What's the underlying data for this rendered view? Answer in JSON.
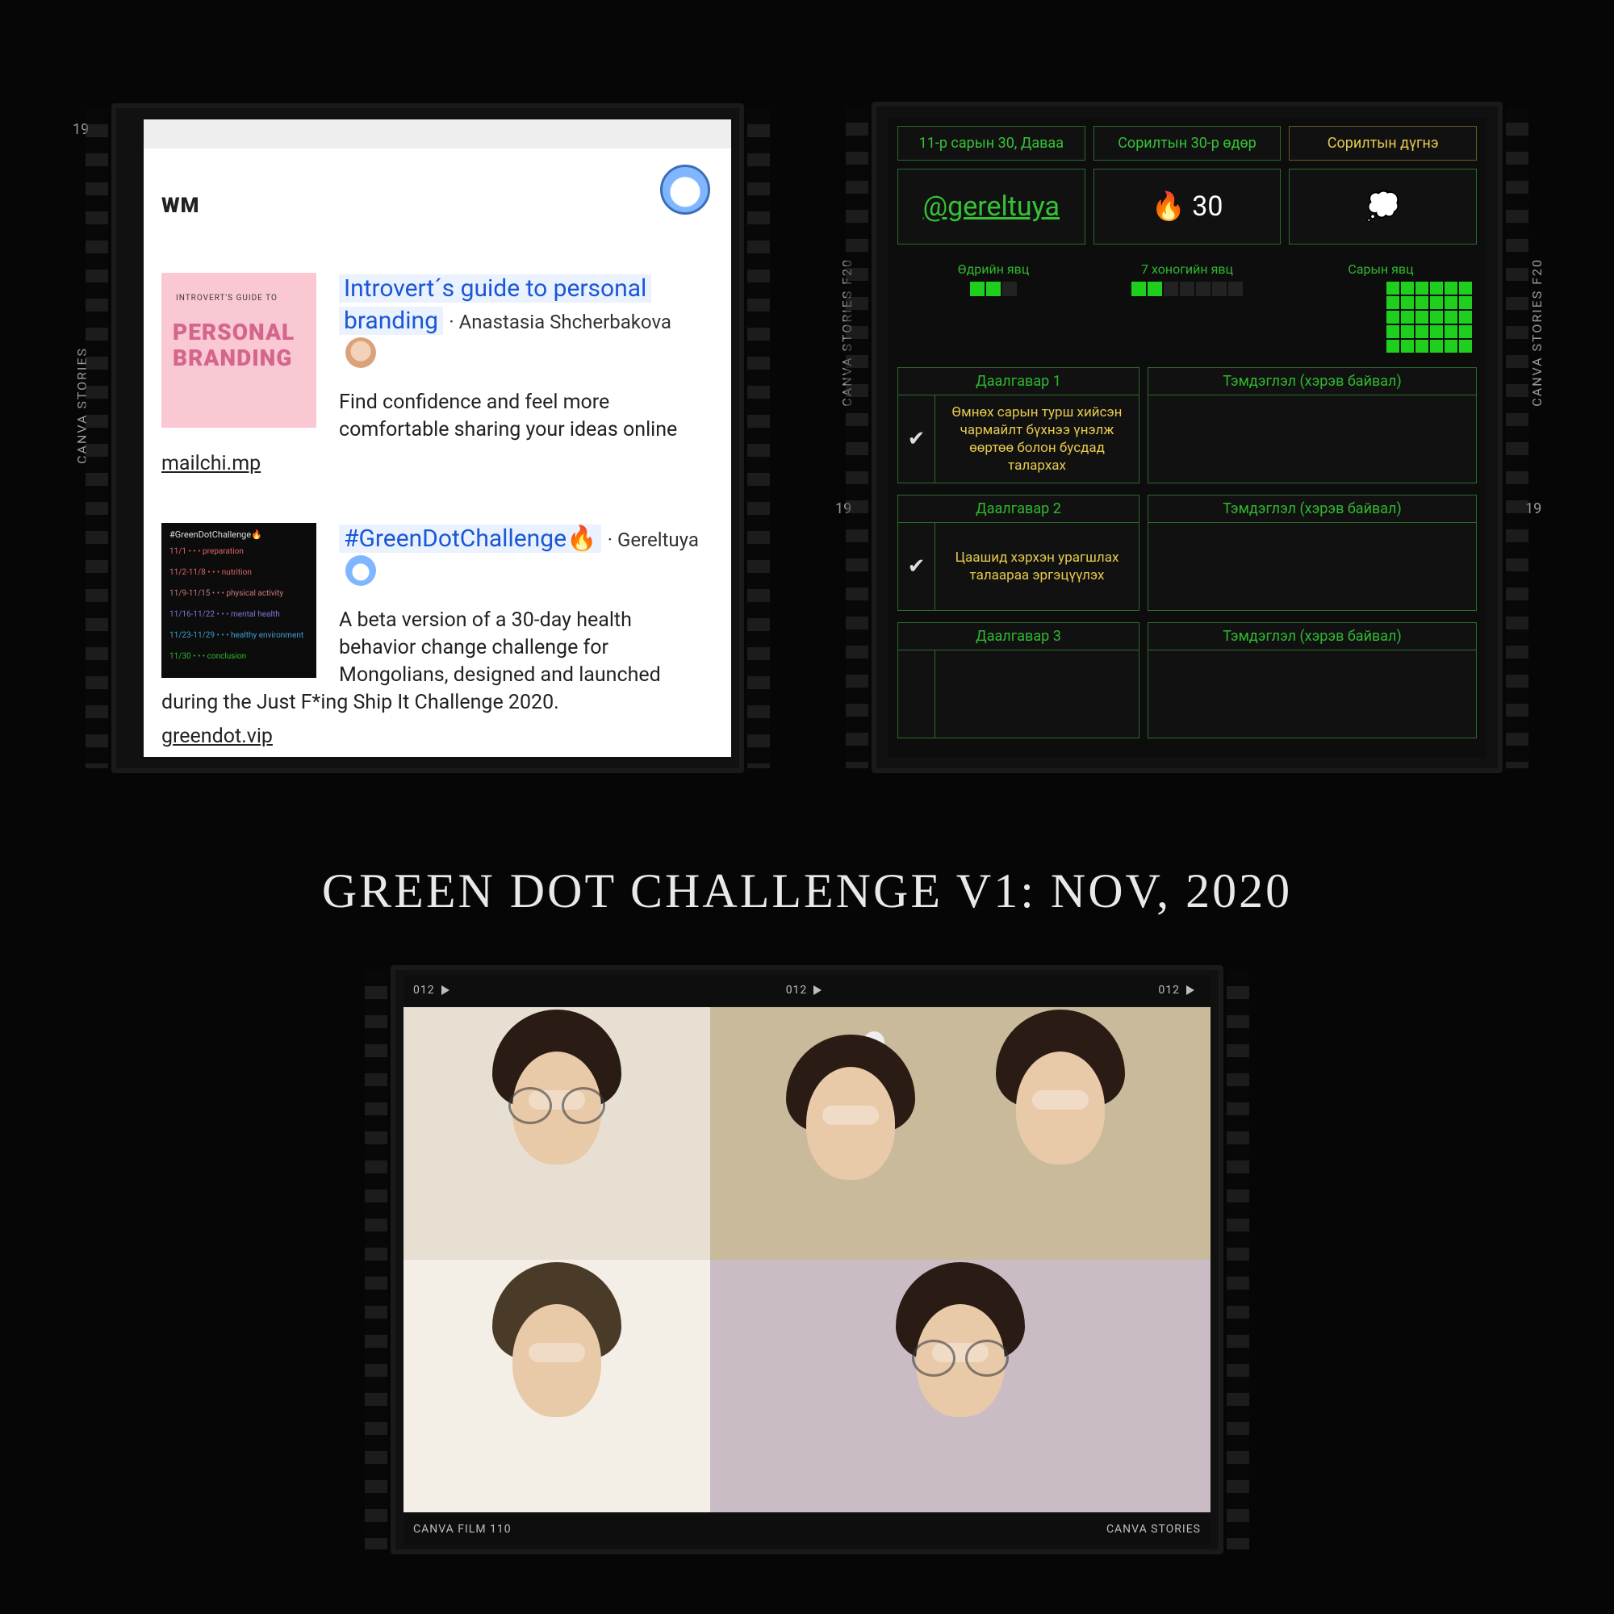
{
  "frame_labels": {
    "canva_stories": "CANVA STORIES",
    "canva_stories_f20": "CANVA STORIES F20",
    "canva_film_110": "CANVA FILM 110",
    "num19": "19",
    "num012": "012"
  },
  "panelA": {
    "brand": "WM",
    "article1": {
      "thumb_guide": "INTROVERT'S GUIDE TO",
      "thumb_big1": "PERSONAL",
      "thumb_big2": "BRANDING",
      "title_part1": "Introvert´s guide to personal",
      "title_part2": "branding",
      "byline_sep": " · ",
      "author": "Anastasia Shcherbakova",
      "desc": "Find confidence and feel more comfortable sharing your ideas online",
      "link": "mailchi.mp"
    },
    "article2": {
      "thumb_hdr": "#GreenDotChallenge🔥",
      "rows": [
        {
          "d": "11/1",
          "c": "#d66",
          "t": "preparation"
        },
        {
          "d": "11/2-11/8",
          "c": "#d66",
          "t": "nutrition"
        },
        {
          "d": "11/9-11/15",
          "c": "#c77",
          "t": "physical activity"
        },
        {
          "d": "11/16-11/22",
          "c": "#7a7ad6",
          "t": "mental health"
        },
        {
          "d": "11/23-11/29",
          "c": "#3aa0d6",
          "t": "healthy environment"
        },
        {
          "d": "11/30",
          "c": "#2fb82f",
          "t": "conclusion"
        }
      ],
      "title": "#GreenDotChallenge🔥",
      "byline_sep": " · ",
      "author": "Gereltuya",
      "desc": "A beta version of a 30-day health behavior change challenge for Mongolians, designed and launched during the Just F*ing Ship It Challenge 2020.",
      "link": "greendot.vip"
    }
  },
  "panelB": {
    "header": {
      "c1": "11-р сарын 30, Даваа",
      "c2": "Сорилтын 30-р өдөр",
      "c3": "Сорилтын дүгнэ"
    },
    "big": {
      "handle": "@gereltuya",
      "streak": "🔥  30",
      "cloud": "💭"
    },
    "progress": {
      "day_label": "Өдрийн явц",
      "week_label": "7 хоногийн явц",
      "month_label": "Сарын явц",
      "day_on": 2,
      "day_total": 3,
      "week_on": 2,
      "week_total": 7,
      "month_on": 30,
      "month_total": 30
    },
    "tasks": [
      {
        "hdr": "Даалгавар 1",
        "text": "Өмнөх сарын турш хийсэн чармайлт бүхнээ үнэлж өөртөө болон бусдад талархах",
        "note_hdr": "Тэмдэглэл (хэрэв байвал)",
        "checked": true
      },
      {
        "hdr": "Даалгавар 2",
        "text": "Цаашид хэрхэн урагшлах талаараа эргэцүүлэх",
        "note_hdr": "Тэмдэглэл (хэрэв байвал)",
        "checked": true
      },
      {
        "hdr": "Даалгавар 3",
        "text": "",
        "note_hdr": "Тэмдэглэл (хэрэв байвал)",
        "checked": false
      }
    ]
  },
  "center_title": "GREEN DOT CHALLENGE V1: NOV, 2020",
  "panelC": {
    "top_num": "012",
    "bottom_left": "CANVA FILM 110",
    "bottom_right": "CANVA STORIES"
  }
}
